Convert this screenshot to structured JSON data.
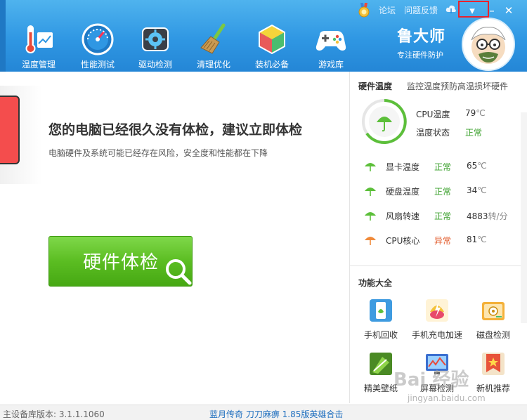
{
  "toolbar": {
    "items": [
      {
        "label": "温度管理",
        "icon": "thermometer-icon"
      },
      {
        "label": "性能测试",
        "icon": "speedometer-icon"
      },
      {
        "label": "驱动检测",
        "icon": "driver-gear-icon"
      },
      {
        "label": "清理优化",
        "icon": "broom-icon"
      },
      {
        "label": "装机必备",
        "icon": "package-box-icon"
      },
      {
        "label": "游戏库",
        "icon": "gamepad-icon"
      }
    ],
    "links": {
      "forum": "论坛",
      "feedback": "问题反馈"
    },
    "window_controls": {
      "menu": "▾",
      "minimize": "–",
      "close": "✕"
    }
  },
  "brand": {
    "name": "鲁大师",
    "slogan": "专注硬件防护"
  },
  "main": {
    "headline": "您的电脑已经很久没有体检，建议立即体检",
    "subline": "电脑硬件及系统可能已经存在风险，安全度和性能都在下降",
    "check_button": "硬件体检"
  },
  "hardware_temp": {
    "title": "硬件温度",
    "desc": "监控温度预防高温损坏硬件",
    "cpu_temp_label": "CPU温度",
    "cpu_temp_value": "79",
    "temp_unit": "℃",
    "temp_state_label": "温度状态",
    "temp_state_value": "正常",
    "rows": [
      {
        "label": "显卡温度",
        "status": "正常",
        "value": "65",
        "unit": "℃",
        "ok": true
      },
      {
        "label": "硬盘温度",
        "status": "正常",
        "value": "34",
        "unit": "℃",
        "ok": true
      },
      {
        "label": "风扇转速",
        "status": "正常",
        "value": "4883",
        "unit": "转/分",
        "ok": true
      },
      {
        "label": "CPU核心",
        "status": "异常",
        "value": "81",
        "unit": "℃",
        "ok": false
      }
    ]
  },
  "functions": {
    "title": "功能大全",
    "items": [
      {
        "label": "手机回收",
        "icon": "phone-recycle-icon"
      },
      {
        "label": "手机充电加速",
        "icon": "charge-boost-icon"
      },
      {
        "label": "磁盘检测",
        "icon": "disk-check-icon"
      },
      {
        "label": "精美壁纸",
        "icon": "wallpaper-icon"
      },
      {
        "label": "屏幕检测",
        "icon": "screen-check-icon"
      },
      {
        "label": "新机推荐",
        "icon": "recommend-icon"
      }
    ]
  },
  "status_bar": {
    "version": "主设备库版本: 3.1.1.1060",
    "promo": "蓝月传奇  刀刀麻痹  1.85版英雄合击"
  },
  "watermark": {
    "main": "Bai 经验",
    "sub": "jingyan.baidu.com"
  },
  "colors": {
    "topbar": "#2f97e3",
    "ok": "#3aa02b",
    "alert": "#e25a2a",
    "button": "#5bbd22",
    "highlight": "#e8232d"
  }
}
